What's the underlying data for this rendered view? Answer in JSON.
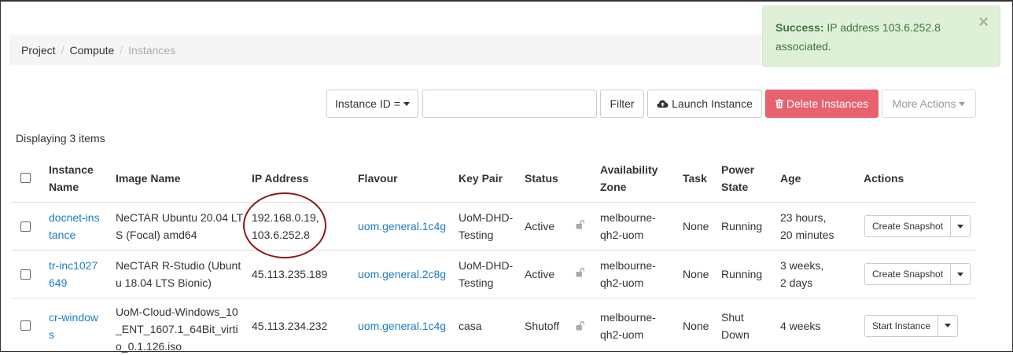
{
  "breadcrumb": [
    "Project",
    "Compute",
    "Instances"
  ],
  "alert": {
    "label": "Success:",
    "message": "IP address 103.6.252.8",
    "message2": "associated.",
    "close": "×"
  },
  "toolbar": {
    "filter_field": "Instance ID =",
    "filter_value": "",
    "filter_button": "Filter",
    "launch_button": "Launch Instance",
    "delete_button": "Delete Instances",
    "more_button": "More Actions"
  },
  "count_text": "Displaying 3 items",
  "table": {
    "headers": {
      "name": [
        "Instance",
        "Name"
      ],
      "image": "Image Name",
      "ip": "IP Address",
      "flavour": "Flavour",
      "keypair": "Key Pair",
      "status": "Status",
      "az": [
        "Availability",
        "Zone"
      ],
      "task": "Task",
      "power": [
        "Power",
        "State"
      ],
      "age": "Age",
      "actions": "Actions"
    },
    "rows": [
      {
        "name": [
          "docnet-ins",
          "tance"
        ],
        "image": [
          "NeCTAR Ubuntu 20.04 LT",
          "S (Focal) amd64"
        ],
        "ip": [
          "192.168.0.19,",
          "103.6.252.8"
        ],
        "flavour": "uom.general.1c4g",
        "keypair": [
          "UoM-DHD-",
          "Testing"
        ],
        "status": "Active",
        "az": [
          "melbourne-",
          "qh2-uom"
        ],
        "task": "None",
        "power": "Running",
        "age": [
          "23 hours,",
          "20 minutes"
        ],
        "action": "Create Snapshot"
      },
      {
        "name": [
          "tr-inc1027",
          "649"
        ],
        "image": [
          "NeCTAR R-Studio (Ubunt",
          "u 18.04 LTS Bionic)"
        ],
        "ip": [
          "45.113.235.189"
        ],
        "flavour": "uom.general.2c8g",
        "keypair": [
          "UoM-DHD-",
          "Testing"
        ],
        "status": "Active",
        "az": [
          "melbourne-",
          "qh2-uom"
        ],
        "task": "None",
        "power": "Running",
        "age": [
          "3 weeks,",
          "2 days"
        ],
        "action": "Create Snapshot"
      },
      {
        "name": [
          "cr-window",
          "s"
        ],
        "image": [
          "UoM-Cloud-Windows_10",
          "_ENT_1607.1_64Bit_virti",
          "o_0.1.126.iso"
        ],
        "ip": [
          "45.113.234.232"
        ],
        "flavour": "uom.general.1c4g",
        "keypair": [
          "casa"
        ],
        "status": "Shutoff",
        "az": [
          "melbourne-",
          "qh2-uom"
        ],
        "task": "None",
        "power": [
          "Shut",
          "Down"
        ],
        "age": [
          "4 weeks"
        ],
        "action": "Start Instance"
      }
    ]
  },
  "colors": {
    "link": "#1a7dc6",
    "danger": "#e8616f",
    "success_bg": "#dff0d8",
    "success_text": "#3c763d",
    "annotation_circle": "#8b1a1a"
  }
}
